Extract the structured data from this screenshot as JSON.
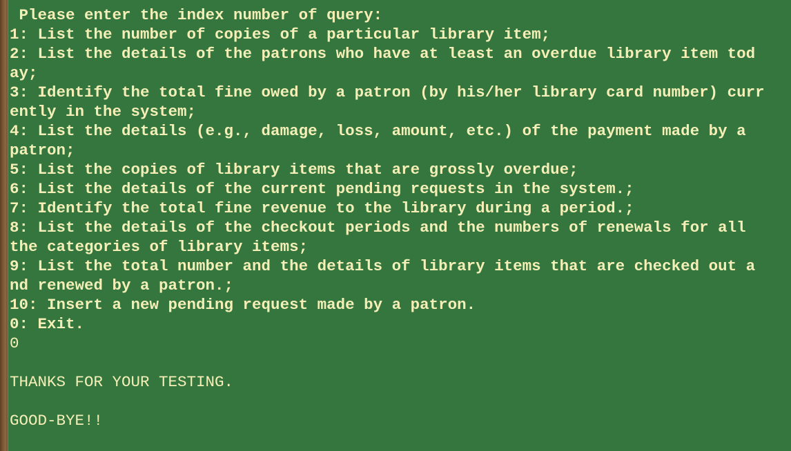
{
  "terminal": {
    "lines": [
      " Please enter the index number of query:",
      "1: List the number of copies of a particular library item;",
      "2: List the details of the patrons who have at least an overdue library item tod",
      "ay;",
      "3: Identify the total fine owed by a patron (by his/her library card number) curr",
      "ently in the system;",
      "4: List the details (e.g., damage, loss, amount, etc.) of the payment made by a",
      "patron;",
      "5: List the copies of library items that are grossly overdue;",
      "6: List the details of the current pending requests in the system.;",
      "7: Identify the total fine revenue to the library during a period.;",
      "8: List the details of the checkout periods and the numbers of renewals for all",
      "the categories of library items;",
      "9: List the total number and the details of library items that are checked out a",
      "nd renewed by a patron.;",
      "10: Insert a new pending request made by a patron.",
      "0: Exit.",
      "0",
      "",
      "THANKS FOR YOUR TESTING.",
      "",
      "GOOD-BYE!!"
    ]
  }
}
